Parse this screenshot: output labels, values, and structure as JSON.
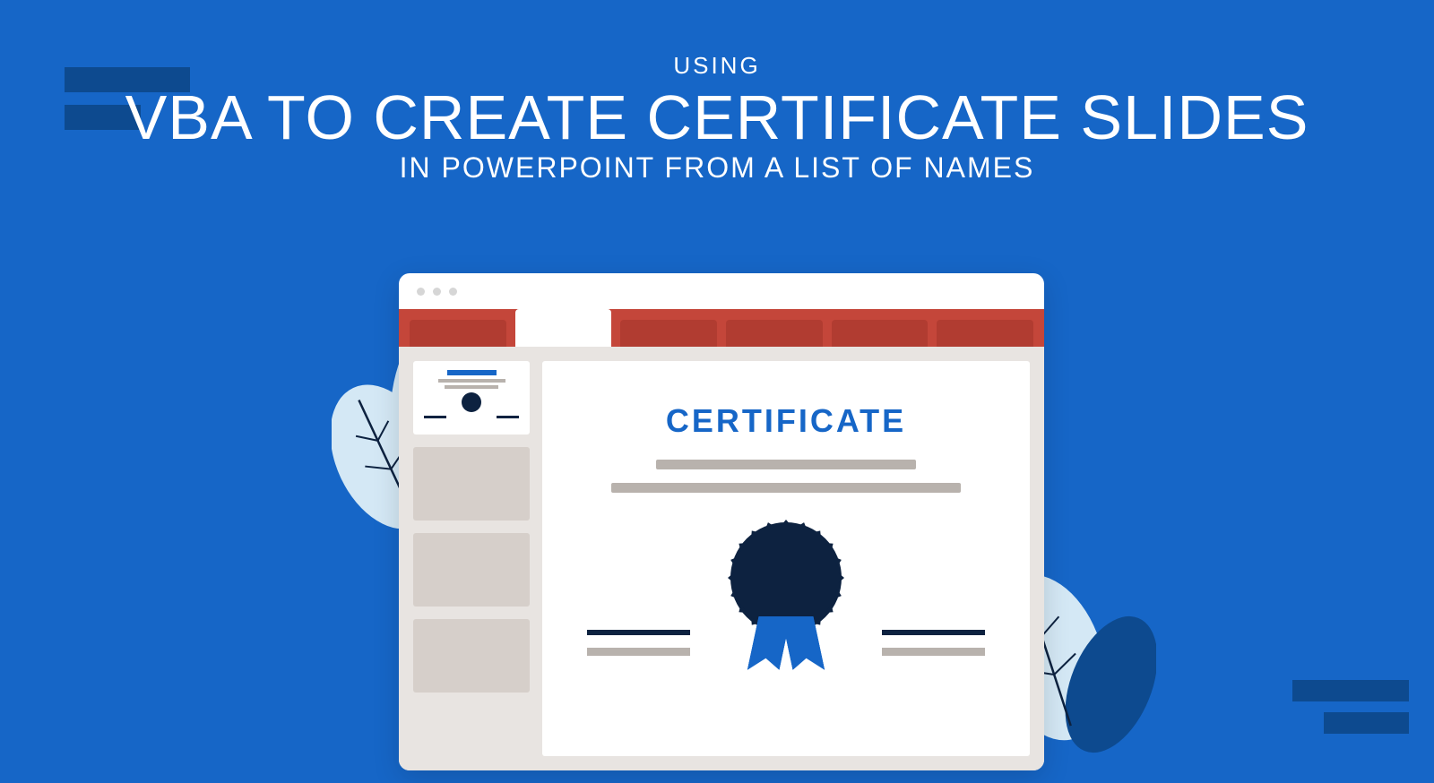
{
  "heading": {
    "pre": "USING",
    "main": "VBA TO CREATE CERTIFICATE SLIDES",
    "sub": "IN POWERPOINT FROM A LIST OF NAMES"
  },
  "certificate": {
    "title": "CERTIFICATE"
  }
}
